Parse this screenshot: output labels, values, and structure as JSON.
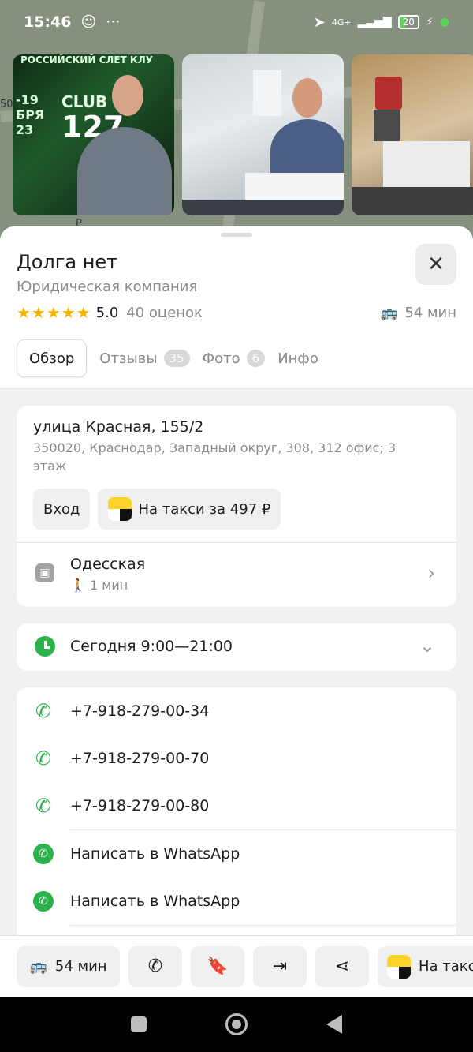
{
  "status_bar": {
    "time": "15:46",
    "network": "4G+",
    "battery": "20"
  },
  "map": {
    "label_left": "50",
    "label_p": "P"
  },
  "photos": {
    "photo1_banner": "РОССИЙСКИЙ СЛЕТ КЛУ",
    "photo1_club": "CLUB",
    "photo1_number": "127",
    "photo1_date": "-19 БРЯ 23"
  },
  "place": {
    "title": "Долга нет",
    "category": "Юридическая компания",
    "rating": "5.0",
    "reviews": "40 оценок",
    "eta": "54 мин"
  },
  "tabs": [
    {
      "label": "Обзор"
    },
    {
      "label": "Отзывы",
      "count": "35"
    },
    {
      "label": "Фото",
      "count": "6"
    },
    {
      "label": "Инфо"
    }
  ],
  "address": {
    "street": "улица Красная, 155/2",
    "full": "350020, Краснодар, Западный округ, 308, 312 офис; 3 этаж",
    "entrance_label": "Вход",
    "taxi_label": "На такси за 497 ₽"
  },
  "transit": {
    "stop": "Одесская",
    "walk": "1 мин"
  },
  "hours": {
    "text": "Сегодня 9:00—21:00"
  },
  "contacts": {
    "phones": [
      "+7-918-279-00-34",
      "+7-918-279-00-70",
      "+7-918-279-00-80"
    ],
    "whatsapp": [
      "Написать в WhatsApp",
      "Написать в WhatsApp"
    ]
  },
  "actions": {
    "route_label": "54 мин",
    "taxi_label": "На такс"
  },
  "colors": {
    "accent_green": "#2bb24c",
    "star": "#f7b500",
    "taxi_yellow": "#fcd32a"
  }
}
